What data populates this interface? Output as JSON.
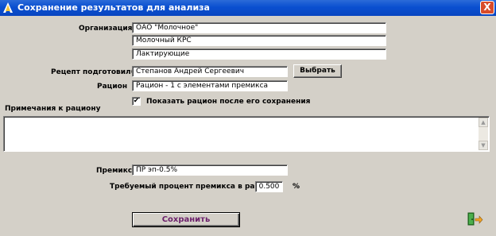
{
  "window": {
    "title": "Сохранение результатов для анализа",
    "close_glyph": "X"
  },
  "organization": {
    "label": "Организация",
    "line1": "ОАО \"Молочное\"",
    "line2": "Молочный КРС",
    "line3": "Лактирующие"
  },
  "recipe_author": {
    "label": "Рецепт подготовил(а)",
    "value": "Степанов Андрей Сергеевич",
    "select_button": "Выбрать"
  },
  "ration": {
    "label": "Рацион",
    "value": "Рацион - 1 с элементами премикса"
  },
  "show_ration": {
    "checked": true,
    "check_glyph": "✔",
    "label": "Показать рацион после его сохранения"
  },
  "notes": {
    "label": "Примечания к рациону",
    "value": ""
  },
  "premix": {
    "label": "Премикс",
    "value": "ПР эп-0.5%"
  },
  "premix_percent": {
    "label": "Требуемый процент премикса в рационе",
    "value": "0.500",
    "unit": "%"
  },
  "save_button": "Сохранить",
  "icons": {
    "app": "app-icon",
    "exit": "exit-door-icon"
  }
}
